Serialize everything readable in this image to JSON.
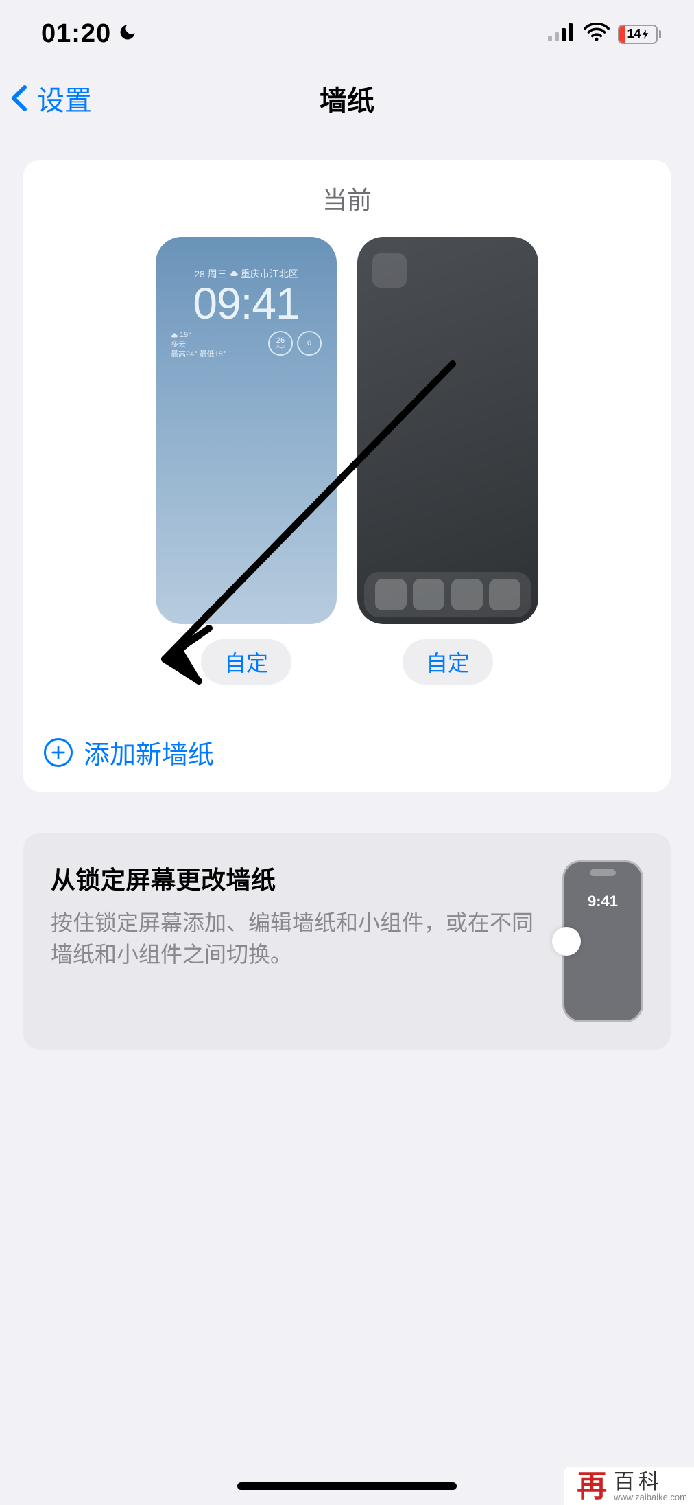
{
  "status": {
    "time": "01:20",
    "battery_percent": "14",
    "battery_charging_glyph": "⚡"
  },
  "nav": {
    "back_label": "设置",
    "title": "墙纸"
  },
  "current": {
    "section_label": "当前",
    "customize_left": "自定",
    "customize_right": "自定",
    "lock": {
      "date_prefix": "28",
      "weekday": "周三",
      "location": "重庆市江北区",
      "time": "09:41",
      "temp": "19°",
      "condition": "多云",
      "hilo": "最高24° 最低18°",
      "aqi_value": "26",
      "aqi_label": "AQI",
      "ring2_value": "0"
    },
    "add_new_label": "添加新墙纸"
  },
  "tip": {
    "title": "从锁定屏幕更改墙纸",
    "desc": "按住锁定屏幕添加、编辑墙纸和小组件，或在不同墙纸和小组件之间切换。",
    "mini_time": "9:41"
  },
  "watermark": {
    "logo": "再",
    "main": "百科",
    "sub": "www.zaibaike.com"
  }
}
